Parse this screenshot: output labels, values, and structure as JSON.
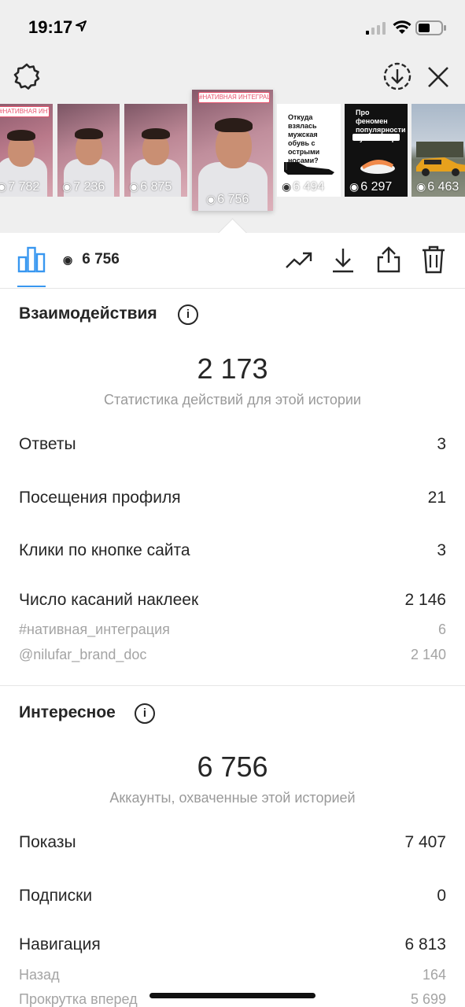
{
  "status_bar": {
    "time": "19:17"
  },
  "thumbnails": [
    {
      "views": "7 782",
      "tag": "#НАТИВНАЯ ИНТЕГРАЦИЯ"
    },
    {
      "views": "7 236"
    },
    {
      "views": "6 875"
    },
    {
      "views": "6 756",
      "tag": "#НАТИВНАЯ ИНТЕГРАЦИЯ",
      "selected": true
    },
    {
      "views": "6 494",
      "caption": "Откуда взялась мужская обувь с острыми носами?"
    },
    {
      "views": "6 297",
      "caption": "Про феномен популярности суши в мире"
    },
    {
      "views": "6 463"
    }
  ],
  "toolbar": {
    "views": "6 756"
  },
  "interactions": {
    "title": "Взаимодействия",
    "total": "2 173",
    "subtitle": "Статистика действий для этой истории",
    "rows": [
      {
        "label": "Ответы",
        "value": "3"
      },
      {
        "label": "Посещения профиля",
        "value": "21"
      },
      {
        "label": "Клики по кнопке сайта",
        "value": "3"
      },
      {
        "label": "Число касаний наклеек",
        "value": "2 146"
      }
    ],
    "sub_rows": [
      {
        "label": "#нативная_интеграция",
        "value": "6"
      },
      {
        "label": "@nilufar_brand_doc",
        "value": "2 140"
      }
    ]
  },
  "discovery": {
    "title": "Интересное",
    "total": "6 756",
    "subtitle": "Аккаунты, охваченные этой историей",
    "rows": [
      {
        "label": "Показы",
        "value": "7 407"
      },
      {
        "label": "Подписки",
        "value": "0"
      },
      {
        "label": "Навигация",
        "value": "6 813"
      }
    ],
    "sub_rows": [
      {
        "label": "Назад",
        "value": "164"
      },
      {
        "label": "Прокрутка вперед",
        "value": "5 699"
      }
    ]
  },
  "colors": {
    "accent": "#3897f0",
    "gray_bg": "#efefef",
    "muted_text": "#9a9a9a"
  }
}
